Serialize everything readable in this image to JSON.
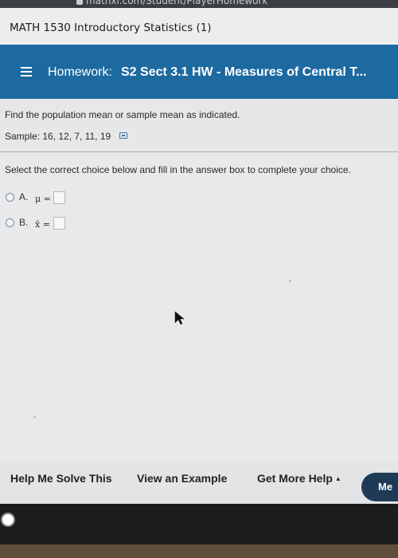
{
  "browser": {
    "url_fragment": "mathxl.com/Student/PlayerHomework"
  },
  "course": {
    "title": "MATH 1530 Introductory Statistics (1)"
  },
  "header": {
    "prefix": "Homework:",
    "title": "S2 Sect 3.1 HW - Measures of Central T...",
    "menu_icon": "hamburger-menu-icon",
    "bg_color": "#1d6aa0"
  },
  "problem": {
    "prompt": "Find the population mean or sample mean as indicated.",
    "sample": "Sample: 16, 12, 7, 11, 19",
    "copy_icon": "copy-data-icon",
    "instruction": "Select the correct choice below and fill in the answer box to complete your choice."
  },
  "choices": [
    {
      "letter": "A.",
      "symbol": "μ =",
      "answer": ""
    },
    {
      "letter": "B.",
      "symbol": "x̄ =",
      "answer": ""
    }
  ],
  "footer": {
    "help_me_solve": "Help Me Solve This",
    "view_example": "View an Example",
    "get_more_help": "Get More Help",
    "get_more_help_caret": "▲",
    "more_button": "Me"
  }
}
